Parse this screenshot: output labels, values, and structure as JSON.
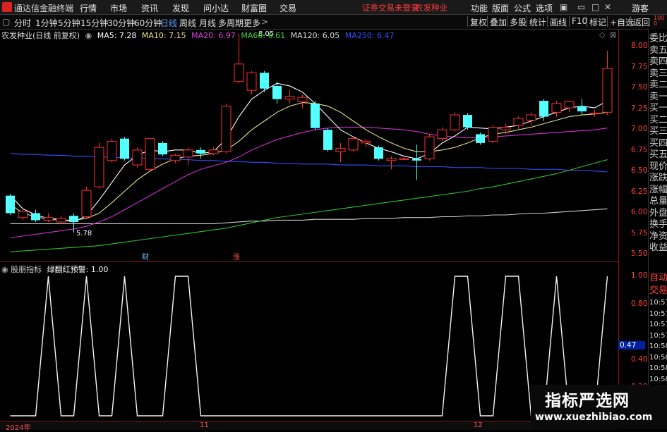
{
  "titlebar": {
    "app_title": "通达信金融终端",
    "menu": [
      "行情",
      "市场",
      "资讯",
      "发现",
      "问小达",
      "财富圈",
      "交易"
    ],
    "warning": "证券交易未登录",
    "stock_name": "农发种业",
    "right_menu": [
      "功能",
      "版面",
      "公式",
      "选项"
    ],
    "guest": "游客"
  },
  "periodbar": {
    "periods": [
      "分时",
      "1分钟",
      "5分钟",
      "15分钟",
      "30分钟",
      "60分钟",
      "日线",
      "周线",
      "月线",
      "多周期",
      "更多"
    ],
    "active": "日线",
    "tools": [
      "复权",
      "叠加",
      "多股",
      "统计",
      "画线",
      "F10",
      "标记",
      "+自选",
      "返回"
    ]
  },
  "legend": {
    "title": "农发种业(日线 前复权)",
    "ma": [
      {
        "label": "MA5: 7.28",
        "color": "#ffffff"
      },
      {
        "label": "MA10: 7.15",
        "color": "#f0e68c"
      },
      {
        "label": "MA20: 6.97",
        "color": "#e040e0"
      },
      {
        "label": "MA60: 6.61",
        "color": "#40d040"
      },
      {
        "label": "MA120: 6.05",
        "color": "#dddddd"
      },
      {
        "label": "MA250: 6.47",
        "color": "#3050ff"
      }
    ]
  },
  "price_axis": [
    "8.00",
    "7.75",
    "7.50",
    "7.25",
    "7.00",
    "6.75",
    "6.50",
    "6.25",
    "6.00",
    "5.75",
    "5.50"
  ],
  "indicator_axis": [
    "1.00",
    "0.80",
    "0.47",
    "0.40",
    "0.20"
  ],
  "annotations": {
    "high": "8.05",
    "low": "5.78",
    "cai": "财",
    "zhang": "涨"
  },
  "indicator": {
    "name": "股朋指标",
    "signal": "绿翻红预警:",
    "value": "1.00",
    "current": "0.47"
  },
  "right_panel": {
    "labels": [
      "委比",
      "卖五",
      "卖四",
      "卖三",
      "卖二",
      "卖一",
      "买一",
      "买二",
      "买三",
      "买四",
      "买五",
      "现价",
      "涨跌",
      "涨幅",
      "总量",
      "外盘",
      "换手",
      "净资",
      "收益"
    ],
    "bottom": [
      "自动",
      "交易"
    ],
    "times": [
      "10:57",
      "10:57",
      "10:57",
      "10:57",
      "10:58",
      "10:58",
      "10:58",
      "10:58",
      "10:58",
      "10:58"
    ],
    "top_digits": "1000"
  },
  "dates": [
    "2024年",
    "11",
    "12"
  ],
  "watermark": {
    "line1": "指标严选网",
    "line2": "www.xuezhibiao.com"
  },
  "chart_data": {
    "type": "candlestick",
    "ylim": [
      5.45,
      8.1
    ],
    "candles": [
      {
        "o": 6.0,
        "c": 6.2,
        "h": 6.22,
        "l": 5.98,
        "up": false
      },
      {
        "o": 5.95,
        "c": 6.02,
        "h": 6.05,
        "l": 5.92,
        "up": true
      },
      {
        "o": 6.0,
        "c": 5.92,
        "h": 6.04,
        "l": 5.9,
        "up": false
      },
      {
        "o": 5.92,
        "c": 5.95,
        "h": 6.0,
        "l": 5.9,
        "up": true
      },
      {
        "o": 5.9,
        "c": 5.94,
        "h": 5.97,
        "l": 5.88,
        "up": true
      },
      {
        "o": 5.97,
        "c": 5.9,
        "h": 6.0,
        "l": 5.78,
        "up": false
      },
      {
        "o": 5.96,
        "c": 6.26,
        "h": 6.3,
        "l": 5.94,
        "up": true
      },
      {
        "o": 6.3,
        "c": 6.75,
        "h": 6.8,
        "l": 6.28,
        "up": true
      },
      {
        "o": 6.6,
        "c": 6.82,
        "h": 6.85,
        "l": 6.58,
        "up": true
      },
      {
        "o": 6.85,
        "c": 6.62,
        "h": 6.87,
        "l": 6.6,
        "up": false
      },
      {
        "o": 6.55,
        "c": 6.72,
        "h": 6.75,
        "l": 6.52,
        "up": true
      },
      {
        "o": 6.5,
        "c": 6.85,
        "h": 6.86,
        "l": 6.48,
        "up": true
      },
      {
        "o": 6.8,
        "c": 6.67,
        "h": 6.82,
        "l": 6.65,
        "up": false
      },
      {
        "o": 6.6,
        "c": 6.66,
        "h": 6.68,
        "l": 6.57,
        "up": true
      },
      {
        "o": 6.64,
        "c": 6.72,
        "h": 6.75,
        "l": 6.55,
        "up": true
      },
      {
        "o": 6.72,
        "c": 6.68,
        "h": 6.75,
        "l": 6.62,
        "up": false
      },
      {
        "o": 6.68,
        "c": 6.72,
        "h": 6.75,
        "l": 6.66,
        "up": true
      },
      {
        "o": 6.7,
        "c": 7.22,
        "h": 7.25,
        "l": 6.68,
        "up": true
      },
      {
        "o": 7.5,
        "c": 7.7,
        "h": 8.05,
        "l": 7.48,
        "up": true
      },
      {
        "o": 7.6,
        "c": 7.4,
        "h": 7.62,
        "l": 7.35,
        "up": true
      },
      {
        "o": 7.6,
        "c": 7.42,
        "h": 7.62,
        "l": 7.38,
        "up": false
      },
      {
        "o": 7.45,
        "c": 7.3,
        "h": 7.5,
        "l": 7.25,
        "up": false
      },
      {
        "o": 7.3,
        "c": 7.33,
        "h": 7.4,
        "l": 7.25,
        "up": true
      },
      {
        "o": 7.32,
        "c": 7.27,
        "h": 7.35,
        "l": 7.2,
        "up": true
      },
      {
        "o": 7.25,
        "c": 6.97,
        "h": 7.28,
        "l": 6.95,
        "up": false
      },
      {
        "o": 6.95,
        "c": 6.72,
        "h": 6.97,
        "l": 6.7,
        "up": false
      },
      {
        "o": 6.7,
        "c": 6.74,
        "h": 6.8,
        "l": 6.58,
        "up": true
      },
      {
        "o": 6.72,
        "c": 6.85,
        "h": 6.88,
        "l": 6.7,
        "up": true
      },
      {
        "o": 6.82,
        "c": 6.8,
        "h": 6.85,
        "l": 6.75,
        "up": true
      },
      {
        "o": 6.75,
        "c": 6.62,
        "h": 6.77,
        "l": 6.6,
        "up": false
      },
      {
        "o": 6.6,
        "c": 6.62,
        "h": 6.65,
        "l": 6.5,
        "up": true
      },
      {
        "o": 6.62,
        "c": 6.62,
        "h": 6.64,
        "l": 6.6,
        "up": true
      },
      {
        "o": 6.6,
        "c": 6.62,
        "h": 6.78,
        "l": 6.38,
        "up": false
      },
      {
        "o": 6.62,
        "c": 6.87,
        "h": 6.9,
        "l": 6.6,
        "up": true
      },
      {
        "o": 6.85,
        "c": 6.95,
        "h": 6.98,
        "l": 6.82,
        "up": true
      },
      {
        "o": 6.95,
        "c": 7.12,
        "h": 7.15,
        "l": 6.93,
        "up": true
      },
      {
        "o": 7.12,
        "c": 6.98,
        "h": 7.14,
        "l": 6.95,
        "up": false
      },
      {
        "o": 6.9,
        "c": 6.8,
        "h": 6.92,
        "l": 6.78,
        "up": false
      },
      {
        "o": 6.82,
        "c": 6.98,
        "h": 7.0,
        "l": 6.8,
        "up": true
      },
      {
        "o": 6.95,
        "c": 6.98,
        "h": 7.02,
        "l": 6.9,
        "up": true
      },
      {
        "o": 7.0,
        "c": 7.08,
        "h": 7.1,
        "l": 6.96,
        "up": true
      },
      {
        "o": 7.06,
        "c": 7.12,
        "h": 7.15,
        "l": 7.0,
        "up": true
      },
      {
        "o": 7.28,
        "c": 7.1,
        "h": 7.3,
        "l": 7.05,
        "up": false
      },
      {
        "o": 7.15,
        "c": 7.25,
        "h": 7.28,
        "l": 7.1,
        "up": true
      },
      {
        "o": 7.2,
        "c": 7.27,
        "h": 7.28,
        "l": 7.15,
        "up": true
      },
      {
        "o": 7.22,
        "c": 7.16,
        "h": 7.3,
        "l": 7.12,
        "up": false
      },
      {
        "o": 7.14,
        "c": 7.14,
        "h": 7.18,
        "l": 7.1,
        "up": true
      },
      {
        "o": 7.15,
        "c": 7.65,
        "h": 7.85,
        "l": 7.12,
        "up": true
      }
    ],
    "ma5": [
      6.2,
      6.05,
      5.98,
      5.94,
      5.93,
      5.9,
      5.97,
      6.15,
      6.35,
      6.55,
      6.66,
      6.72,
      6.7,
      6.72,
      6.72,
      6.68,
      6.7,
      6.85,
      7.1,
      7.3,
      7.4,
      7.48,
      7.45,
      7.38,
      7.25,
      7.1,
      6.95,
      6.87,
      6.8,
      6.74,
      6.7,
      6.65,
      6.62,
      6.68,
      6.8,
      6.88,
      6.98,
      6.97,
      6.96,
      6.98,
      7.0,
      7.05,
      7.1,
      7.15,
      7.2,
      7.22,
      7.2,
      7.28
    ],
    "ma10": [
      6.1,
      6.0,
      5.96,
      5.93,
      5.92,
      5.92,
      5.94,
      6.0,
      6.12,
      6.25,
      6.38,
      6.48,
      6.56,
      6.62,
      6.65,
      6.66,
      6.68,
      6.72,
      6.82,
      6.95,
      7.05,
      7.15,
      7.22,
      7.26,
      7.25,
      7.22,
      7.15,
      7.05,
      6.95,
      6.87,
      6.8,
      6.74,
      6.7,
      6.7,
      6.72,
      6.75,
      6.8,
      6.86,
      6.9,
      6.92,
      6.95,
      6.98,
      7.02,
      7.06,
      7.1,
      7.12,
      7.13,
      7.15
    ],
    "ma20": [
      5.72,
      5.74,
      5.76,
      5.78,
      5.8,
      5.82,
      5.85,
      5.9,
      5.96,
      6.04,
      6.12,
      6.2,
      6.28,
      6.36,
      6.44,
      6.5,
      6.54,
      6.58,
      6.64,
      6.72,
      6.78,
      6.84,
      6.88,
      6.92,
      6.95,
      6.97,
      6.98,
      6.98,
      6.98,
      6.97,
      6.96,
      6.95,
      6.93,
      6.9,
      6.88,
      6.87,
      6.86,
      6.86,
      6.87,
      6.88,
      6.89,
      6.9,
      6.91,
      6.92,
      6.93,
      6.94,
      6.95,
      6.97
    ],
    "ma60": [
      5.56,
      5.57,
      5.58,
      5.59,
      5.6,
      5.61,
      5.62,
      5.63,
      5.65,
      5.67,
      5.69,
      5.71,
      5.73,
      5.75,
      5.77,
      5.79,
      5.81,
      5.83,
      5.86,
      5.89,
      5.92,
      5.95,
      5.97,
      5.99,
      6.01,
      6.03,
      6.05,
      6.07,
      6.09,
      6.11,
      6.13,
      6.15,
      6.17,
      6.19,
      6.21,
      6.23,
      6.25,
      6.28,
      6.3,
      6.33,
      6.36,
      6.39,
      6.42,
      6.45,
      6.49,
      6.53,
      6.57,
      6.61
    ],
    "ma120": [
      5.88,
      5.88,
      5.88,
      5.88,
      5.88,
      5.88,
      5.88,
      5.88,
      5.88,
      5.88,
      5.88,
      5.88,
      5.88,
      5.88,
      5.88,
      5.88,
      5.88,
      5.89,
      5.9,
      5.91,
      5.91,
      5.92,
      5.92,
      5.92,
      5.93,
      5.93,
      5.93,
      5.93,
      5.94,
      5.94,
      5.94,
      5.95,
      5.95,
      5.95,
      5.96,
      5.96,
      5.97,
      5.97,
      5.98,
      5.98,
      5.99,
      6.0,
      6.0,
      6.01,
      6.02,
      6.03,
      6.04,
      6.05
    ],
    "ma250": [
      6.68,
      6.67,
      6.67,
      6.66,
      6.66,
      6.65,
      6.65,
      6.64,
      6.64,
      6.63,
      6.63,
      6.62,
      6.62,
      6.61,
      6.61,
      6.6,
      6.6,
      6.59,
      6.59,
      6.58,
      6.58,
      6.57,
      6.57,
      6.56,
      6.56,
      6.56,
      6.55,
      6.55,
      6.55,
      6.54,
      6.54,
      6.54,
      6.53,
      6.53,
      6.53,
      6.52,
      6.52,
      6.52,
      6.51,
      6.51,
      6.51,
      6.5,
      6.5,
      6.5,
      6.49,
      6.49,
      6.48,
      6.47
    ],
    "indicator_ylim": [
      0,
      1.0
    ],
    "indicator_values": [
      0,
      0,
      0,
      1,
      0,
      0,
      1,
      0,
      0,
      1,
      0,
      0,
      0,
      1,
      1,
      0,
      0,
      0,
      0,
      0,
      0,
      0,
      0,
      0,
      0,
      0,
      0,
      0,
      0,
      0,
      0,
      0,
      0,
      0,
      0,
      1,
      1,
      0,
      0,
      1,
      1,
      0,
      0,
      1,
      0,
      0,
      0,
      1
    ]
  }
}
